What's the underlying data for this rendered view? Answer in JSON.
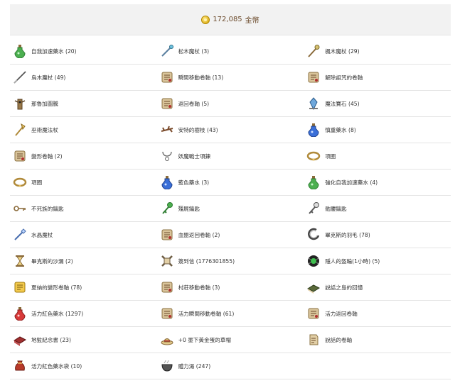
{
  "header": {
    "gold_amount": "172,085",
    "currency": "金幣"
  },
  "items": [
    [
      {
        "label": "自我加速藥水 (20)",
        "icon": "green-potion-icon"
      },
      {
        "label": "松木魔杖 (3)",
        "icon": "wand-icon"
      },
      {
        "label": "楓木魔杖 (29)",
        "icon": "staff-icon"
      }
    ],
    [
      {
        "label": "烏木魔杖 (49)",
        "icon": "ebony-wand-icon"
      },
      {
        "label": "瞬間移動卷軸 (13)",
        "icon": "scroll-icon"
      },
      {
        "label": "解除詛咒的卷軸",
        "icon": "scroll-icon"
      }
    ],
    [
      {
        "label": "那魯加圖騰",
        "icon": "totem-icon"
      },
      {
        "label": "返回卷軸 (5)",
        "icon": "scroll-icon"
      },
      {
        "label": "魔法寶石 (45)",
        "icon": "magic-gem-icon"
      }
    ],
    [
      {
        "label": "巫術魔法杖",
        "icon": "sorcery-staff-icon"
      },
      {
        "label": "安特的樹枝 (43)",
        "icon": "branch-icon"
      },
      {
        "label": "慎重藥水 (8)",
        "icon": "blue-potion-icon"
      }
    ],
    [
      {
        "label": "變形卷軸 (2)",
        "icon": "scroll-icon"
      },
      {
        "label": "妖魔戰士項鍊",
        "icon": "necklace-icon"
      },
      {
        "label": "項圈",
        "icon": "collar-icon"
      }
    ],
    [
      {
        "label": "項圈",
        "icon": "collar-icon"
      },
      {
        "label": "藍色藥水 (3)",
        "icon": "blue-potion-icon"
      },
      {
        "label": "強化自我加速藥水 (4)",
        "icon": "green-potion-icon"
      }
    ],
    [
      {
        "label": "不死族的鑰匙",
        "icon": "key-icon"
      },
      {
        "label": "殭屍鑰匙",
        "icon": "green-key-icon"
      },
      {
        "label": "骷髏鑰匙",
        "icon": "skull-key-icon"
      }
    ],
    [
      {
        "label": "水晶魔杖",
        "icon": "crystal-wand-icon"
      },
      {
        "label": "血盟返回卷軸 (2)",
        "icon": "scroll-icon"
      },
      {
        "label": "畢克斯的羽毛 (78)",
        "icon": "feather-icon"
      }
    ],
    [
      {
        "label": "畢克斯的沙漏 (2)",
        "icon": "hourglass-icon"
      },
      {
        "label": "簽到信 (1776301855)",
        "icon": "letter-icon"
      },
      {
        "label": "隱人的盔輪(1小時) (5)",
        "icon": "dark-orb-icon"
      }
    ],
    [
      {
        "label": "夏納的變形卷軸 (78)",
        "icon": "gold-scroll-icon"
      },
      {
        "label": "村莊移動卷軸 (3)",
        "icon": "scroll-icon"
      },
      {
        "label": "說話之島的回憶",
        "icon": "book-icon"
      }
    ],
    [
      {
        "label": "活力紅色藥水 (1297)",
        "icon": "red-potion-icon"
      },
      {
        "label": "活力瞬間移動卷軸 (61)",
        "icon": "scroll-icon"
      },
      {
        "label": "活力返回卷軸",
        "icon": "scroll-icon"
      }
    ],
    [
      {
        "label": "地監紀念書 (23)",
        "icon": "red-book-icon"
      },
      {
        "label": "+0 墨下黃金蛋的草帽",
        "icon": "straw-hat-icon"
      },
      {
        "label": "說話的卷軸",
        "icon": "paper-scroll-icon"
      }
    ],
    [
      {
        "label": "活力紅色藥水袋 (10)",
        "icon": "potion-bag-icon"
      },
      {
        "label": "體力湯 (247)",
        "icon": "soup-icon"
      }
    ]
  ]
}
